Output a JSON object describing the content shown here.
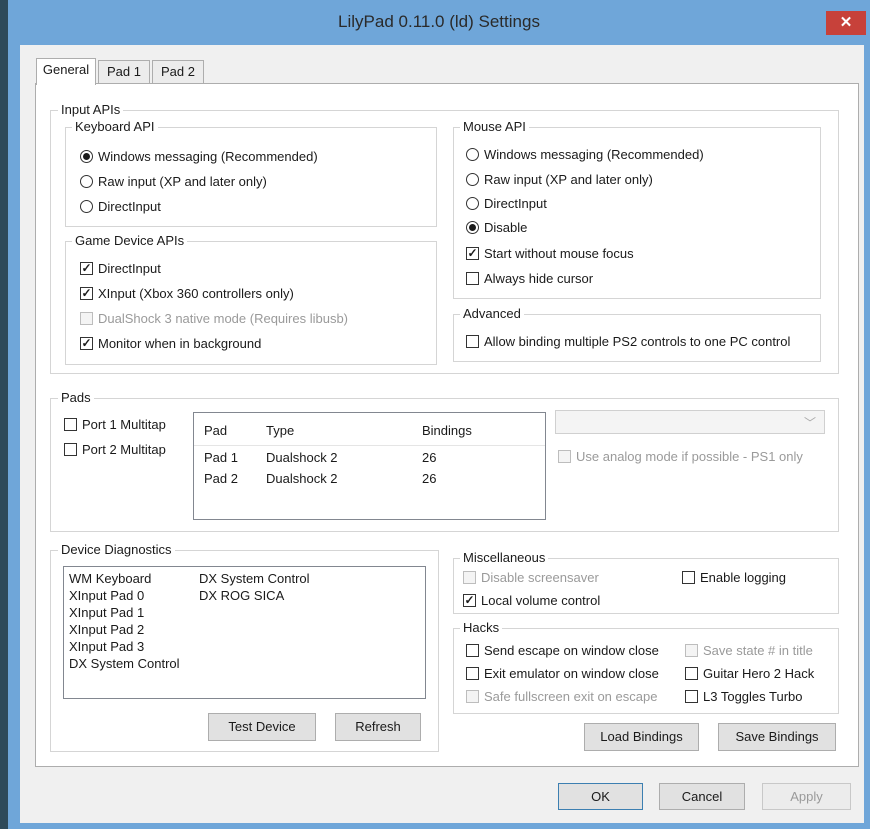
{
  "window": {
    "title": "LilyPad 0.11.0 (ld) Settings",
    "close_glyph": "✕"
  },
  "tabs": [
    {
      "label": "General"
    },
    {
      "label": "Pad 1"
    },
    {
      "label": "Pad 2"
    }
  ],
  "input_apis": {
    "label": "Input APIs",
    "keyboard": {
      "label": "Keyboard API",
      "options": [
        "Windows messaging (Recommended)",
        "Raw input (XP and later only)",
        "DirectInput"
      ],
      "selected": "Windows messaging (Recommended)"
    },
    "game_device": {
      "label": "Game Device APIs",
      "options": [
        {
          "label": "DirectInput",
          "checked": true
        },
        {
          "label": "XInput (Xbox 360 controllers only)",
          "checked": true
        },
        {
          "label": "DualShock 3 native mode (Requires libusb)",
          "checked": false,
          "disabled": true
        },
        {
          "label": "Monitor when in background",
          "checked": true
        }
      ]
    },
    "mouse": {
      "label": "Mouse API",
      "options": [
        "Windows messaging (Recommended)",
        "Raw input (XP and later only)",
        "DirectInput",
        "Disable"
      ],
      "selected": "Disable",
      "checks": [
        {
          "label": "Start without mouse focus",
          "checked": true
        },
        {
          "label": "Always hide cursor",
          "checked": false
        }
      ]
    },
    "advanced": {
      "label": "Advanced",
      "checks": [
        {
          "label": "Allow binding multiple PS2 controls to one PC control",
          "checked": false
        }
      ]
    }
  },
  "pads": {
    "label": "Pads",
    "port1": "Port 1 Multitap",
    "port2": "Port 2 Multitap",
    "columns": [
      "Pad",
      "Type",
      "Bindings"
    ],
    "rows": [
      [
        "Pad 1",
        "Dualshock 2",
        "26"
      ],
      [
        "Pad 2",
        "Dualshock 2",
        "26"
      ]
    ],
    "analog": "Use analog mode if possible - PS1 only"
  },
  "diagnostics": {
    "label": "Device Diagnostics",
    "col1": [
      "WM Keyboard",
      "XInput Pad 0",
      "XInput Pad 1",
      "XInput Pad 2",
      "XInput Pad 3",
      "DX System Control"
    ],
    "col2": [
      "DX System Control",
      "DX ROG SICA"
    ],
    "test_button": "Test Device",
    "refresh_button": "Refresh"
  },
  "misc": {
    "label": "Miscellaneous",
    "disable_screensaver": "Disable screensaver",
    "enable_logging": "Enable logging",
    "local_volume": "Local volume control"
  },
  "hacks": {
    "label": "Hacks",
    "send_escape": "Send escape on window close",
    "exit_emulator": "Exit emulator on window close",
    "safe_fullscreen": "Safe fullscreen exit on escape",
    "save_state": "Save state # in title",
    "guitar_hero": "Guitar Hero 2 Hack",
    "l3_turbo": "L3 Toggles Turbo"
  },
  "bindings": {
    "load": "Load Bindings",
    "save": "Save Bindings"
  },
  "footer": {
    "ok": "OK",
    "cancel": "Cancel",
    "apply": "Apply"
  }
}
